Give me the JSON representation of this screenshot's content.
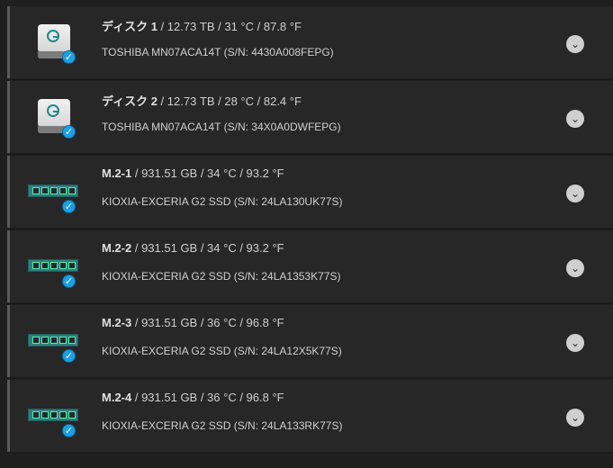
{
  "disks": [
    {
      "type": "hdd",
      "name": "ディスク 1",
      "rest": " / 12.73 TB / 31 °C / 87.8 °F",
      "model": "TOSHIBA MN07ACA14T (S/N: 4430A008FEPG)"
    },
    {
      "type": "hdd",
      "name": "ディスク 2",
      "rest": " / 12.73 TB / 28 °C / 82.4 °F",
      "model": "TOSHIBA MN07ACA14T (S/N: 34X0A0DWFEPG)"
    },
    {
      "type": "m2",
      "name": "M.2-1",
      "rest": " / 931.51 GB / 34 °C / 93.2 °F",
      "model": "KIOXIA-EXCERIA G2 SSD (S/N: 24LA130UK77S)"
    },
    {
      "type": "m2",
      "name": "M.2-2",
      "rest": " / 931.51 GB / 34 °C / 93.2 °F",
      "model": "KIOXIA-EXCERIA G2 SSD (S/N: 24LA1353K77S)"
    },
    {
      "type": "m2",
      "name": "M.2-3",
      "rest": " / 931.51 GB / 36 °C / 96.8 °F",
      "model": "KIOXIA-EXCERIA G2 SSD (S/N: 24LA12X5K77S)"
    },
    {
      "type": "m2",
      "name": "M.2-4",
      "rest": " / 931.51 GB / 36 °C / 96.8 °F",
      "model": "KIOXIA-EXCERIA G2 SSD (S/N: 24LA133RK77S)"
    }
  ],
  "icons": {
    "check": "✓",
    "chevron": "⌄",
    "status_color": "#1aa0e6"
  }
}
